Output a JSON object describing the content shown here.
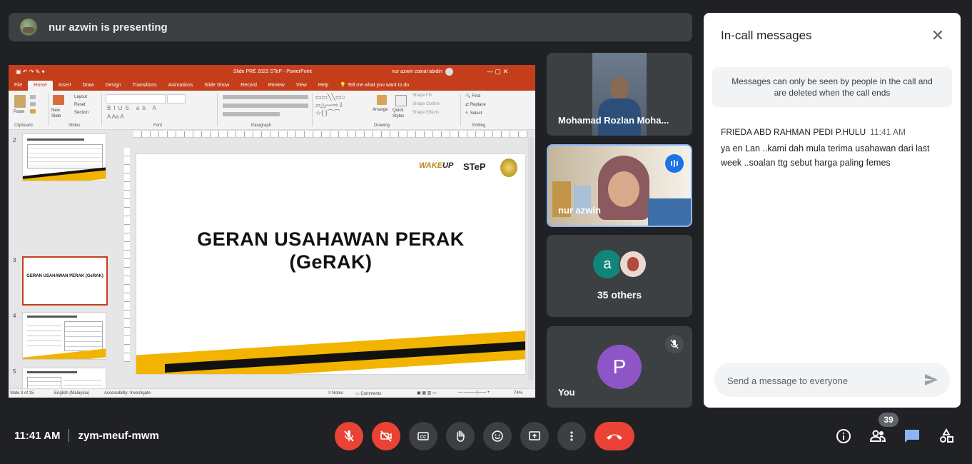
{
  "presenting_bar": {
    "text": "nur azwin is presenting"
  },
  "powerpoint": {
    "title": "Slide PRE 2023 STeP  -  PowerPoint",
    "user": "nur azwin zainal abidin",
    "tabs": [
      "File",
      "Home",
      "Insert",
      "Draw",
      "Design",
      "Transitions",
      "Animations",
      "Slide Show",
      "Record",
      "Review",
      "View",
      "Help"
    ],
    "active_tab": "Home",
    "tell_me": "Tell me what you want to do",
    "groups": {
      "clipboard": "Clipboard",
      "slides": "Slides",
      "font": "Font",
      "paragraph": "Paragraph",
      "drawing": "Drawing",
      "editing": "Editing"
    },
    "paste": "Paste",
    "new_slide": "New Slide",
    "layout": "Layout",
    "reset": "Reset",
    "section": "Section",
    "arrange": "Arrange",
    "quick_styles": "Quick Styles",
    "shape_fill": "Shape Fill",
    "shape_outline": "Shape Outline",
    "shape_effects": "Shape Effects",
    "find": "Find",
    "replace": "Replace",
    "select": "Select",
    "thumb_numbers": [
      "2",
      "3",
      "4",
      "5",
      "6"
    ],
    "thumb_title_3": "GERAN USAHAWAN PERAK (GeRAK)",
    "slide_title_line1": "GERAN USAHAWAN PERAK",
    "slide_title_line2": "(GeRAK)",
    "logo_step": "STeP",
    "status_slide": "Slide 3 of 15",
    "status_lang": "English (Malaysia)",
    "status_access": "Accessibility: Investigate",
    "status_notes": "Notes",
    "status_comments": "Comments",
    "zoom": "74%"
  },
  "tiles": {
    "tile1_name": "Mohamad Rozlan Moha...",
    "tile2_name": "nur azwin",
    "tile3_initial": "a",
    "tile3_label": "35 others",
    "tile4_initial": "P",
    "tile4_name": "You"
  },
  "chat": {
    "title": "In-call messages",
    "note": "Messages can only be seen by people in the call and are deleted when the call ends",
    "sender": "FRIEDA ABD RAHMAN PEDI P.HULU",
    "time": "11:41 AM",
    "message": "ya en Lan ..kami dah mula terima usahawan dari last week ..soalan ttg sebut harga paling femes",
    "placeholder": "Send a message to everyone"
  },
  "bottom": {
    "time": "11:41 AM",
    "meeting_code": "zym-meuf-mwm",
    "people_count": "39"
  },
  "colors": {
    "background": "#202124",
    "tile": "#3c4043",
    "red": "#ea4335",
    "accent_blue": "#8ab4f8",
    "ppt_red": "#c43e1c",
    "avatar_a": "#12857b",
    "avatar_p": "#8e55c7"
  }
}
